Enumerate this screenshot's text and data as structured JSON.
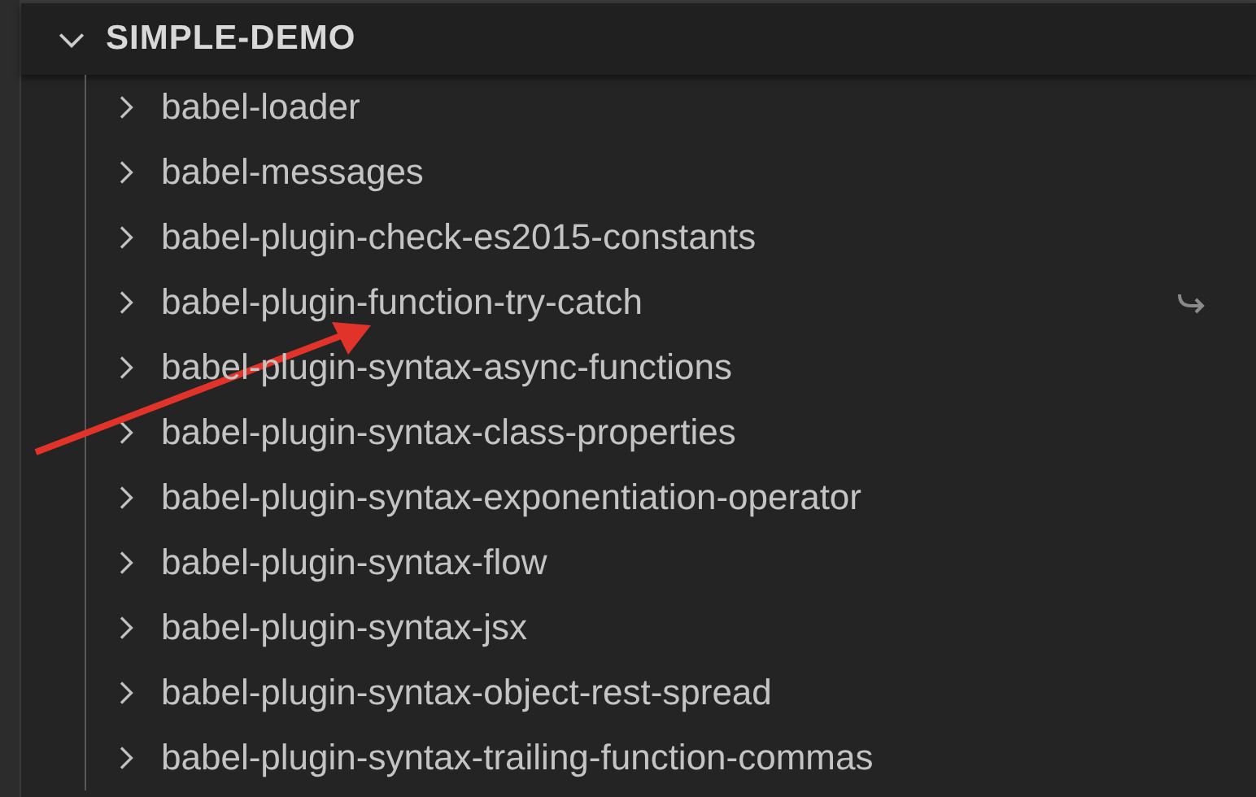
{
  "section": {
    "title": "SIMPLE-DEMO",
    "expanded": true
  },
  "items": [
    {
      "label": "babel-loader",
      "expanded": false,
      "symlink": false
    },
    {
      "label": "babel-messages",
      "expanded": false,
      "symlink": false
    },
    {
      "label": "babel-plugin-check-es2015-constants",
      "expanded": false,
      "symlink": false
    },
    {
      "label": "babel-plugin-function-try-catch",
      "expanded": false,
      "symlink": true
    },
    {
      "label": "babel-plugin-syntax-async-functions",
      "expanded": false,
      "symlink": false
    },
    {
      "label": "babel-plugin-syntax-class-properties",
      "expanded": false,
      "symlink": false
    },
    {
      "label": "babel-plugin-syntax-exponentiation-operator",
      "expanded": false,
      "symlink": false
    },
    {
      "label": "babel-plugin-syntax-flow",
      "expanded": false,
      "symlink": false
    },
    {
      "label": "babel-plugin-syntax-jsx",
      "expanded": false,
      "symlink": false
    },
    {
      "label": "babel-plugin-syntax-object-rest-spread",
      "expanded": false,
      "symlink": false
    },
    {
      "label": "babel-plugin-syntax-trailing-function-commas",
      "expanded": false,
      "symlink": false
    }
  ]
}
